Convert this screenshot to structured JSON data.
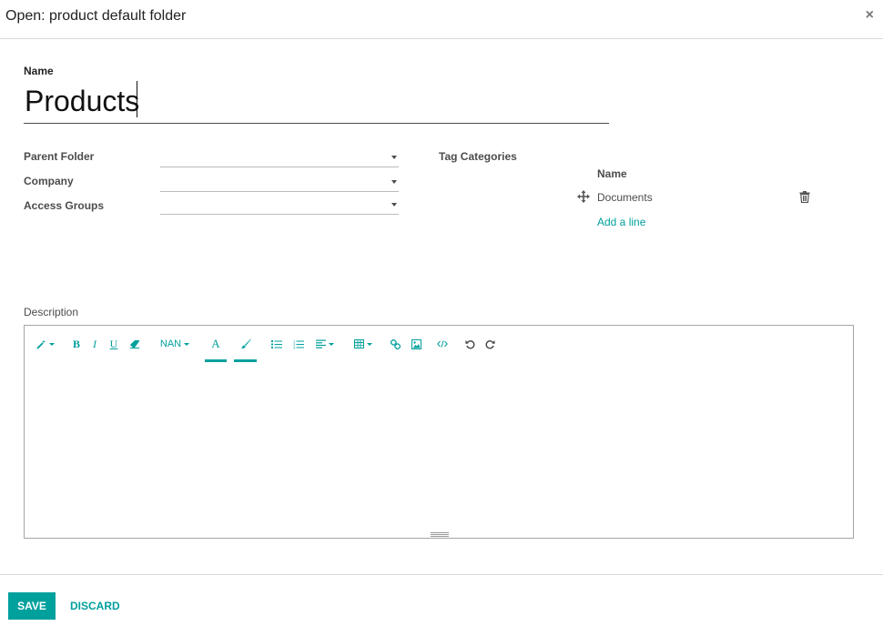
{
  "dialog": {
    "title": "Open: product default folder",
    "close_glyph": "×"
  },
  "form": {
    "name_label": "Name",
    "name_value": "Products",
    "fields": [
      {
        "label": "Parent Folder",
        "value": ""
      },
      {
        "label": "Company",
        "value": ""
      },
      {
        "label": "Access Groups",
        "value": ""
      }
    ],
    "tag_categories": {
      "label": "Tag Categories",
      "column_header": "Name",
      "rows": [
        {
          "name": "Documents"
        }
      ],
      "add_line": "Add a line"
    },
    "description_label": "Description"
  },
  "editor_toolbar": {
    "font_size_label": "NAN",
    "bold": "B",
    "italic": "I",
    "underline": "U",
    "font_color_glyph": "A",
    "icons": [
      "magic-wand-icon",
      "eraser-icon",
      "paint-brush-icon",
      "unordered-list-icon",
      "ordered-list-icon",
      "align-icon",
      "table-icon",
      "link-icon",
      "image-icon",
      "code-view-icon",
      "undo-icon",
      "redo-icon"
    ]
  },
  "footer": {
    "save_label": "SAVE",
    "discard_label": "DISCARD"
  },
  "colors": {
    "accent": "#00a09d",
    "text": "#4c4c4c",
    "border": "#d9d9d9"
  }
}
